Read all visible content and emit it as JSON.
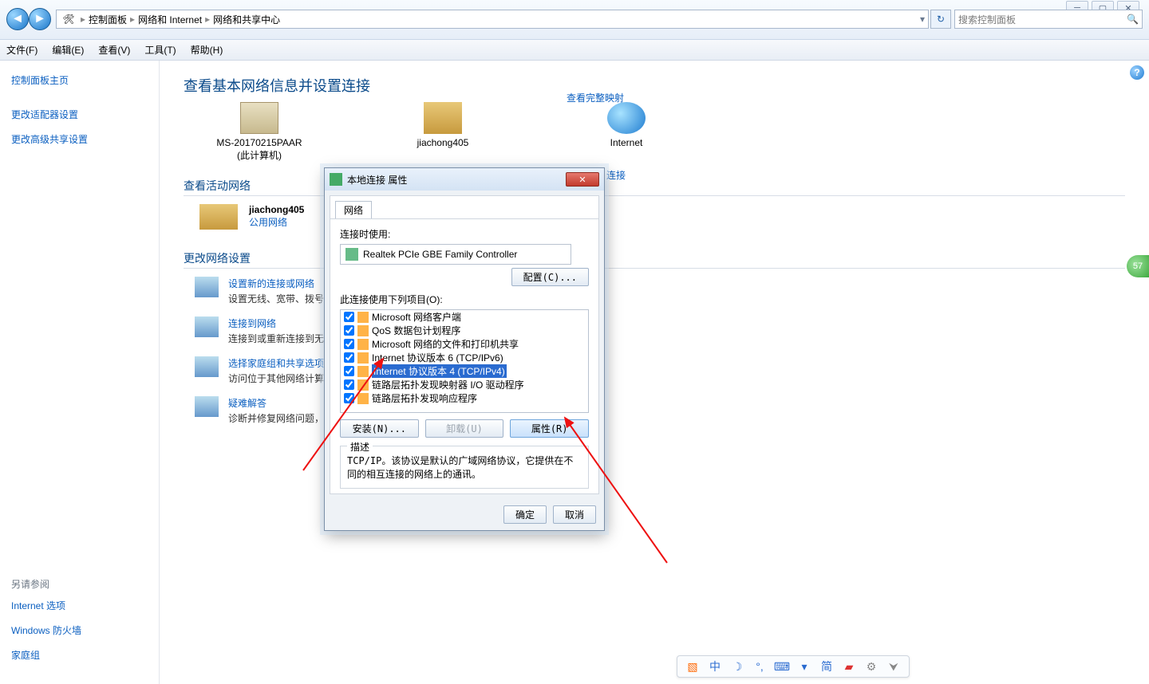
{
  "breadcrumbs": {
    "root": "控制面板",
    "mid": "网络和 Internet",
    "leaf": "网络和共享中心"
  },
  "search_placeholder": "搜索控制面板",
  "menu": {
    "file": "文件(F)",
    "edit": "编辑(E)",
    "view": "查看(V)",
    "tools": "工具(T)",
    "help": "帮助(H)"
  },
  "sidebar": {
    "home": "控制面板主页",
    "adapter": "更改适配器设置",
    "advshare": "更改高级共享设置",
    "seealso": "另请参阅",
    "links": [
      "Internet 选项",
      "Windows 防火墙",
      "家庭组"
    ]
  },
  "page": {
    "title": "查看基本网络信息并设置连接",
    "full_map": "查看完整映射",
    "conn_link": "连接",
    "nodes": {
      "pc": "MS-20170215PAAR",
      "pc_sub": "(此计算机)",
      "router": "jiachong405",
      "net": "Internet"
    },
    "active_hdr": "查看活动网络",
    "active": {
      "name": "jiachong405",
      "type": "公用网络"
    },
    "change_hdr": "更改网络设置",
    "tasks": [
      {
        "t": "设置新的连接或网络",
        "d": "设置无线、宽带、拨号"
      },
      {
        "t": "连接到网络",
        "d": "连接到或重新连接到无"
      },
      {
        "t": "选择家庭组和共享选项",
        "d": "访问位于其他网络计算"
      },
      {
        "t": "疑难解答",
        "d": "诊断并修复网络问题，"
      }
    ]
  },
  "dialog": {
    "title": "本地连接 属性",
    "tab": "网络",
    "connect_using": "连接时使用:",
    "adapter": "Realtek PCIe GBE Family Controller",
    "configure": "配置(C)...",
    "items_lbl": "此连接使用下列项目(O):",
    "items": [
      {
        "c": true,
        "t": "Microsoft 网络客户端"
      },
      {
        "c": true,
        "t": "QoS 数据包计划程序"
      },
      {
        "c": true,
        "t": "Microsoft 网络的文件和打印机共享"
      },
      {
        "c": true,
        "t": "Internet 协议版本 6 (TCP/IPv6)"
      },
      {
        "c": true,
        "t": "Internet 协议版本 4 (TCP/IPv4)",
        "sel": true
      },
      {
        "c": true,
        "t": "链路层拓扑发现映射器 I/O 驱动程序"
      },
      {
        "c": true,
        "t": "链路层拓扑发现响应程序"
      }
    ],
    "install": "安装(N)...",
    "uninstall": "卸载(U)",
    "props": "属性(R)",
    "desc_lbl": "描述",
    "desc": "TCP/IP。该协议是默认的广域网络协议，它提供在不同的相互连接的网络上的通讯。",
    "ok": "确定",
    "cancel": "取消"
  },
  "tray": {
    "items": [
      "中",
      "简"
    ]
  },
  "badge": "57"
}
